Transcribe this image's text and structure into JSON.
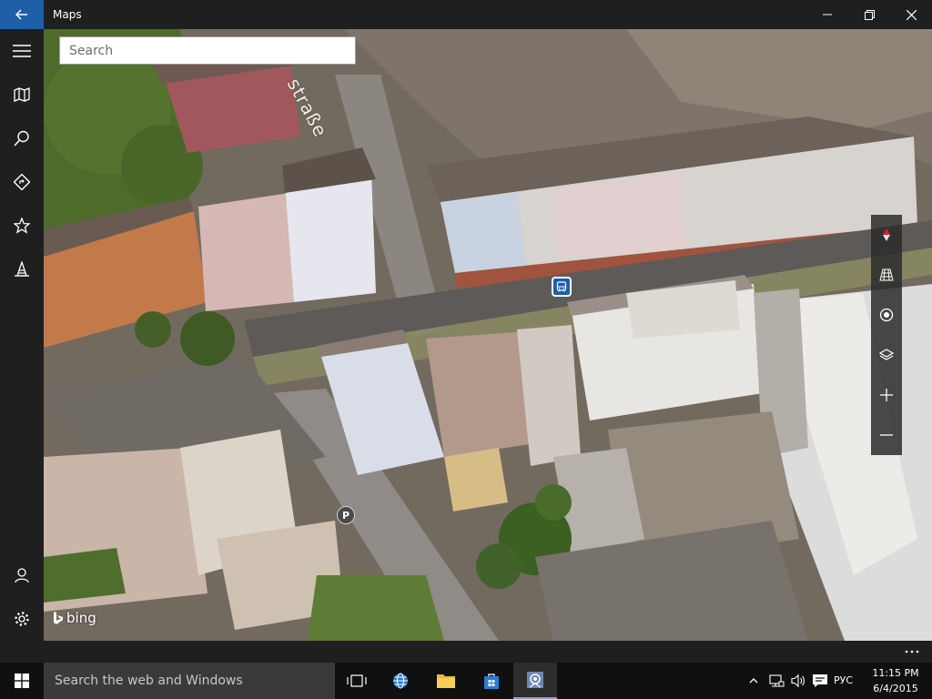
{
  "window": {
    "title": "Maps"
  },
  "nav": {
    "items": [
      {
        "icon": "hamburger-icon"
      },
      {
        "icon": "map-icon"
      },
      {
        "icon": "search-icon"
      },
      {
        "icon": "directions-icon"
      },
      {
        "icon": "favorites-icon"
      },
      {
        "icon": "3d-cities-icon"
      }
    ],
    "bottom": [
      {
        "icon": "account-icon"
      },
      {
        "icon": "settings-icon"
      }
    ]
  },
  "search": {
    "placeholder": "Search"
  },
  "map": {
    "street_label": "straße",
    "parking_label": "P",
    "attribution": "bing"
  },
  "taskbar": {
    "search_placeholder": "Search the web and Windows",
    "language": "РУС",
    "time": "11:15 PM",
    "date": "6/4/2015"
  },
  "colors": {
    "accent": "#1e5fa8",
    "titlebar": "#1f1f1f",
    "taskbar": "#101010"
  }
}
